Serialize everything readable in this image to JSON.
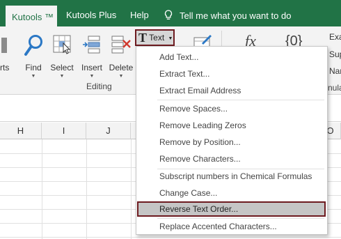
{
  "tabs": {
    "kutools": "Kutools ™",
    "kutools_plus": "Kutools Plus",
    "help": "Help",
    "tell_me": "Tell me what you want to do"
  },
  "ribbon": {
    "arts_label": "rts",
    "find": "Find",
    "select": "Select",
    "insert": "Insert",
    "delete": "Delete",
    "text_button": "Text",
    "group_editing": "Editing",
    "exa": "Exa",
    "sup": "Sup",
    "nar": "Nar",
    "nula": "nula",
    "fx": "fx",
    "braces": "{0}"
  },
  "columns": [
    "H",
    "I",
    "J",
    "O"
  ],
  "menu": {
    "items": [
      "Add Text...",
      "Extract Text...",
      "Extract Email Address",
      "Remove Spaces...",
      "Remove Leading Zeros",
      "Remove by Position...",
      "Remove Characters...",
      "Subscript numbers in Chemical Formulas",
      "Change Case...",
      "Reverse Text Order...",
      "Replace Accented Characters..."
    ]
  },
  "colors": {
    "ribbon_green": "#217346",
    "highlight_border": "#6d1a1f",
    "highlight_fill": "#c5c5c5"
  }
}
